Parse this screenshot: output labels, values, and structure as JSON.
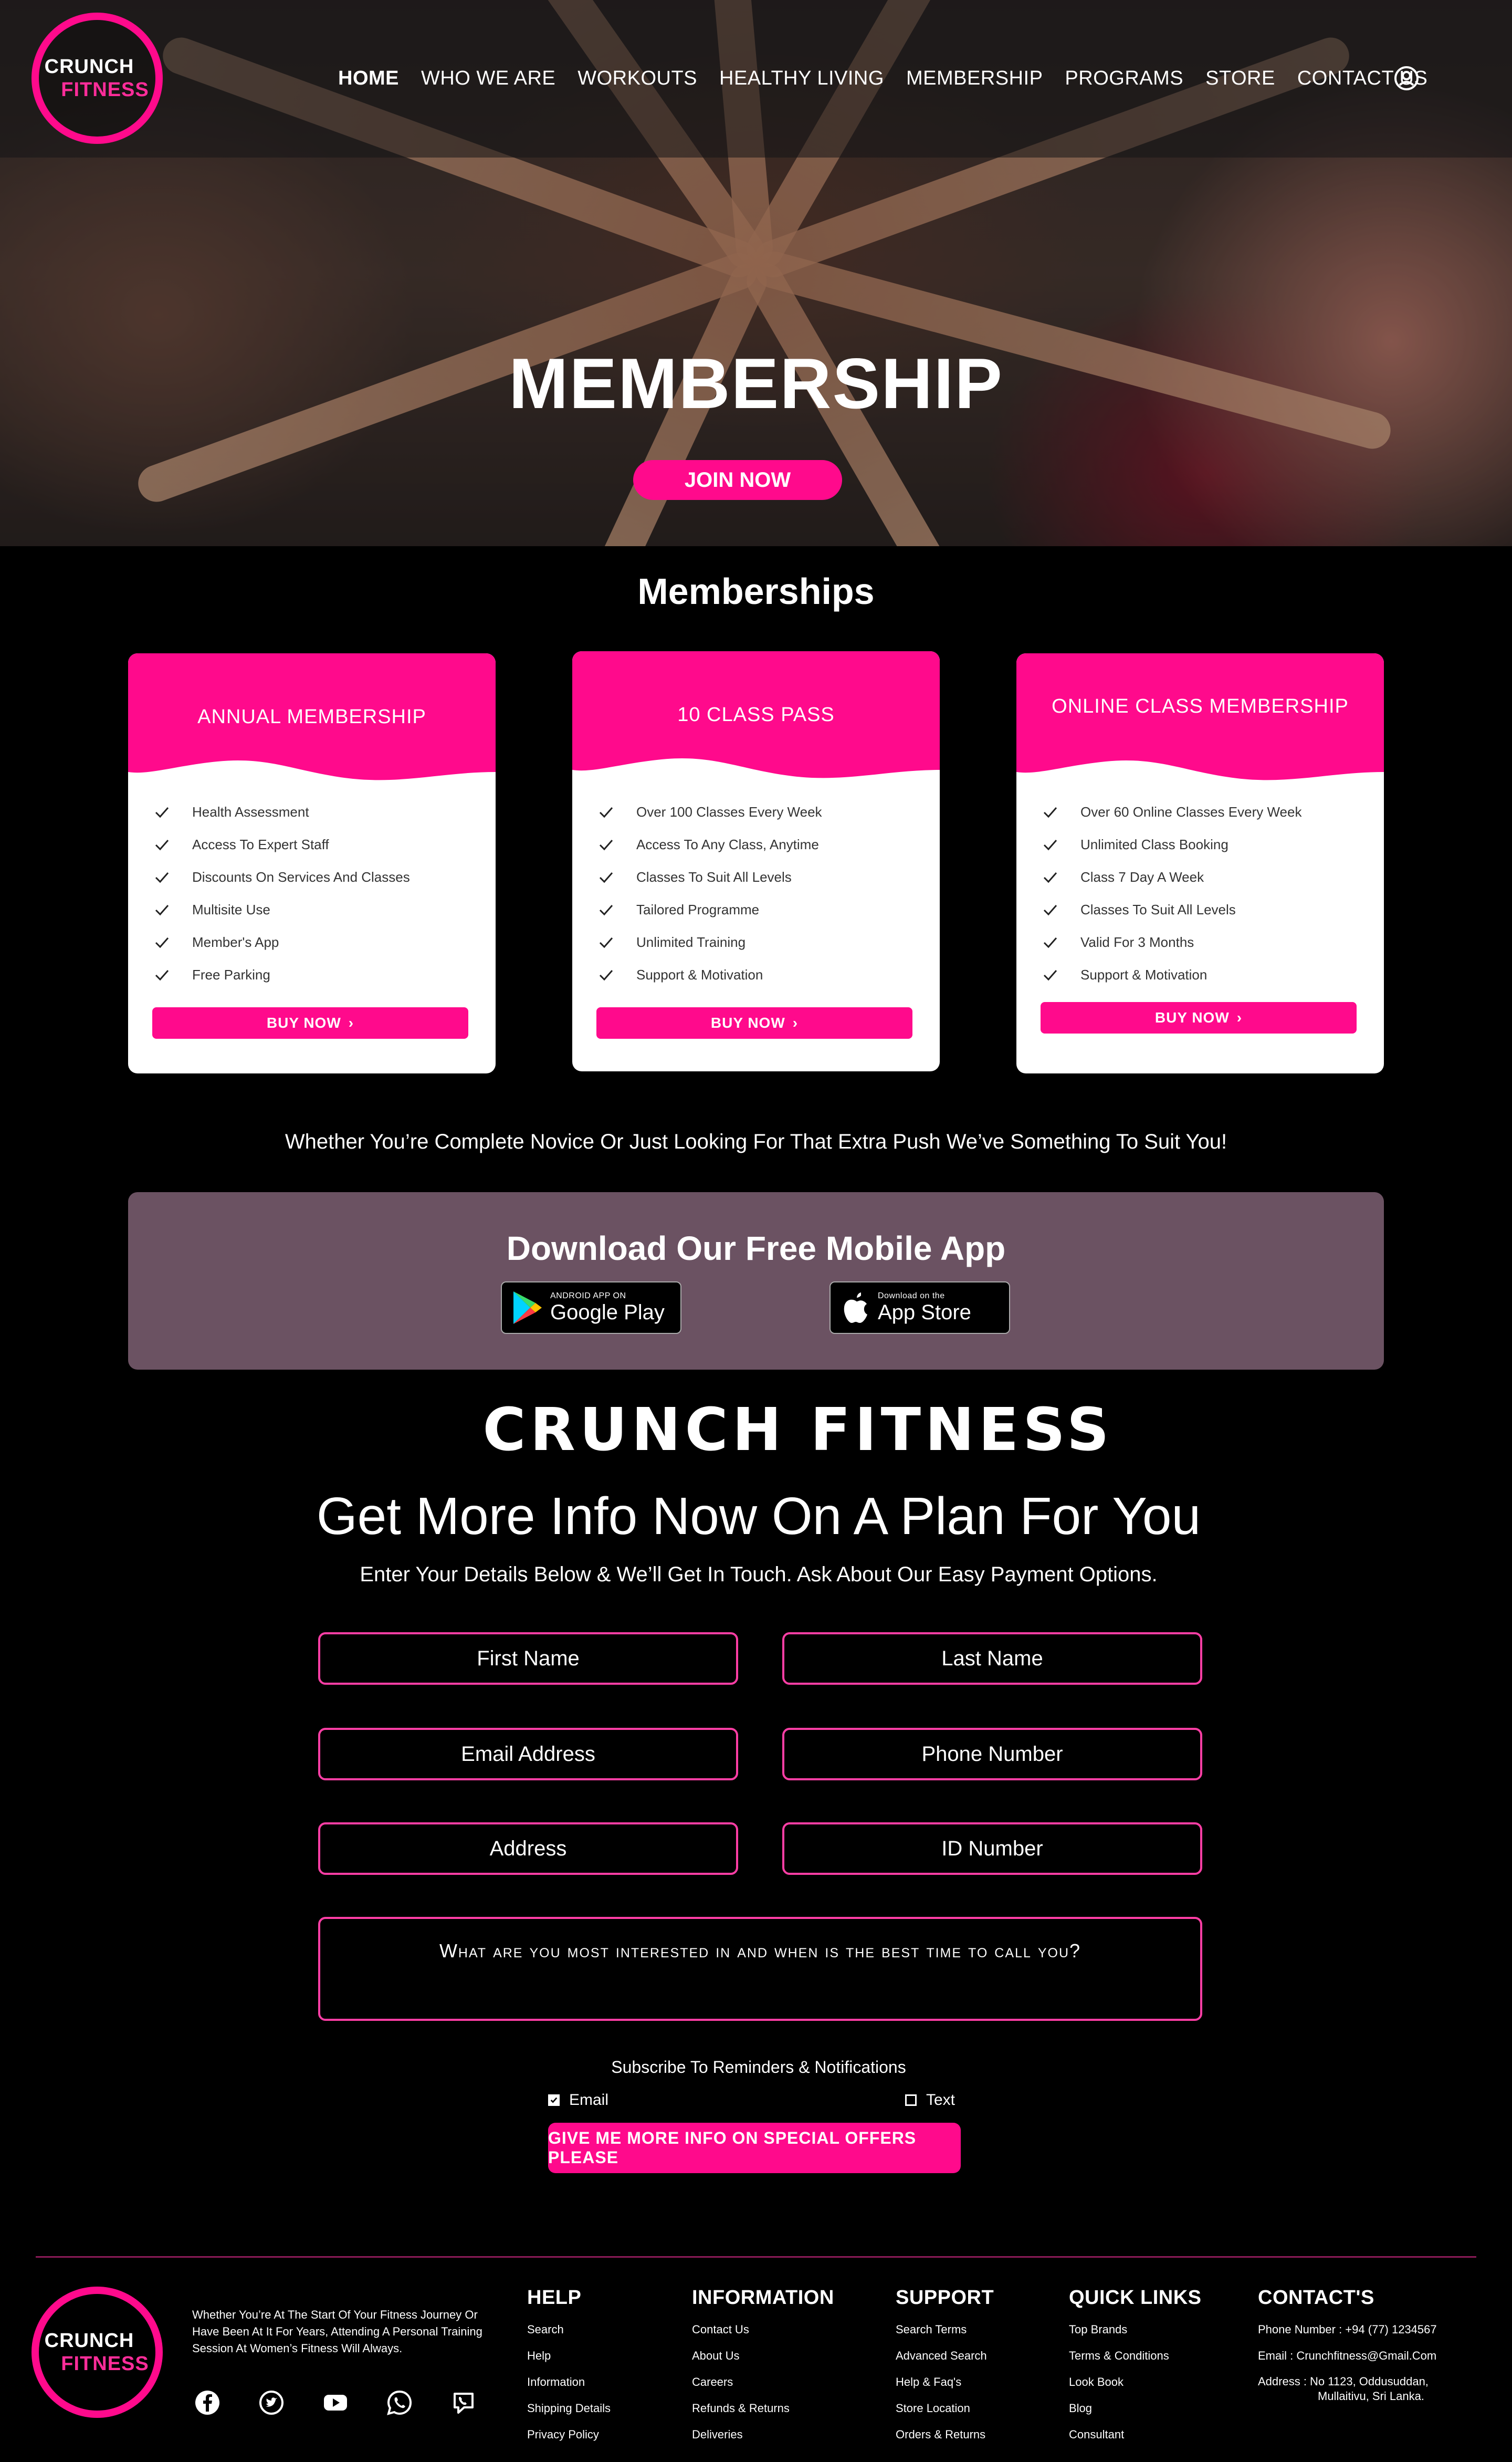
{
  "brand": {
    "line1": "CRUNCH",
    "line2": "FITNESS",
    "wordmark": "CRUNCH FITNESS",
    "accent": "#ff0a8c"
  },
  "nav": [
    "HOME",
    "WHO WE ARE",
    "WORKOUTS",
    "HEALTHY LIVING",
    "MEMBERSHIP",
    "PROGRAMS",
    "STORE",
    "CONTACT US"
  ],
  "user_icon": "user-circle-icon",
  "hero": {
    "title": "MEMBERSHIP",
    "cta": "JOIN NOW"
  },
  "memberships": {
    "title": "Memberships",
    "cards": [
      {
        "title": "ANNUAL MEMBERSHIP",
        "features": [
          "Health Assessment",
          "Access To Expert Staff",
          "Discounts On Services And Classes",
          "Multisite Use",
          "Member's App",
          "Free Parking"
        ],
        "cta": "BUY NOW"
      },
      {
        "title": "10 CLASS PASS",
        "features": [
          "Over 100 Classes Every Week",
          "Access To Any Class, Anytime",
          "Classes To Suit All Levels",
          "Tailored  Programme",
          "Unlimited Training",
          "Support & Motivation"
        ],
        "cta": "BUY NOW"
      },
      {
        "title": "ONLINE CLASS MEMBERSHIP",
        "features": [
          "Over 60 Online Classes Every Week",
          "Unlimited Class Booking",
          "Class 7 Day A Week",
          "Classes To Suit All Levels",
          "Valid For 3 Months",
          "Support & Motivation"
        ],
        "cta": "BUY NOW"
      }
    ]
  },
  "tagline": "Whether You’re Complete Novice Or Just Looking For That Extra Push We’ve Something To Suit You!",
  "app": {
    "title": "Download Our Free Mobile App",
    "google": {
      "small": "ANDROID APP ON",
      "big": "Google Play"
    },
    "apple": {
      "small": "Download on the",
      "big": "App Store"
    }
  },
  "form": {
    "title": "Get More Info Now On A Plan For You",
    "subtitle": "Enter Your Details Below & We’ll Get In Touch. Ask About Our Easy Payment Options.",
    "fields": {
      "first_name": "First Name",
      "last_name": "Last Name",
      "email": "Email Address",
      "phone": "Phone Number",
      "address": "Address",
      "id": "ID Number"
    },
    "message": "What are you most interested in and when is the best time to call you?",
    "subscribe_label": "Subscribe To Reminders & Notifications",
    "opt_email": "Email",
    "opt_email_checked": true,
    "opt_text": "Text",
    "opt_text_checked": false,
    "submit": "GIVE ME MORE INFO ON SPECIAL OFFERS PLEASE"
  },
  "footer": {
    "about": "Whether You’re At The Start Of Your Fitness Journey Or Have Been At It For Years, Attending A Personal Training Session At Women’s Fitness Will Always.",
    "socials": [
      "facebook-icon",
      "twitter-icon",
      "youtube-icon",
      "whatsapp-icon",
      "viber-icon"
    ],
    "help": {
      "title": "HELP",
      "items": [
        "Search",
        "Help",
        "Information",
        "Shipping Details",
        "Privacy Policy"
      ]
    },
    "information": {
      "title": "INFORMATION",
      "items": [
        "Contact Us",
        "About Us",
        "Careers",
        "Refunds & Returns",
        "Deliveries"
      ]
    },
    "support": {
      "title": "SUPPORT",
      "items": [
        "Search Terms",
        "Advanced Search",
        "Help & Faq's",
        "Store Location",
        "Orders & Returns"
      ]
    },
    "quick": {
      "title": "QUICK LINKS",
      "items": [
        "Top Brands",
        "Terms & Conditions",
        "Look Book",
        "Blog",
        "Consultant"
      ]
    },
    "contact": {
      "title": "CONTACT'S",
      "phone": "Phone Number : +94 (77) 1234567",
      "email": "Email : Crunchfitness@Gmail.Com",
      "address1": "Address : No 1123, Oddusuddan,",
      "address2": "Mullaitivu, Sri Lanka."
    }
  }
}
